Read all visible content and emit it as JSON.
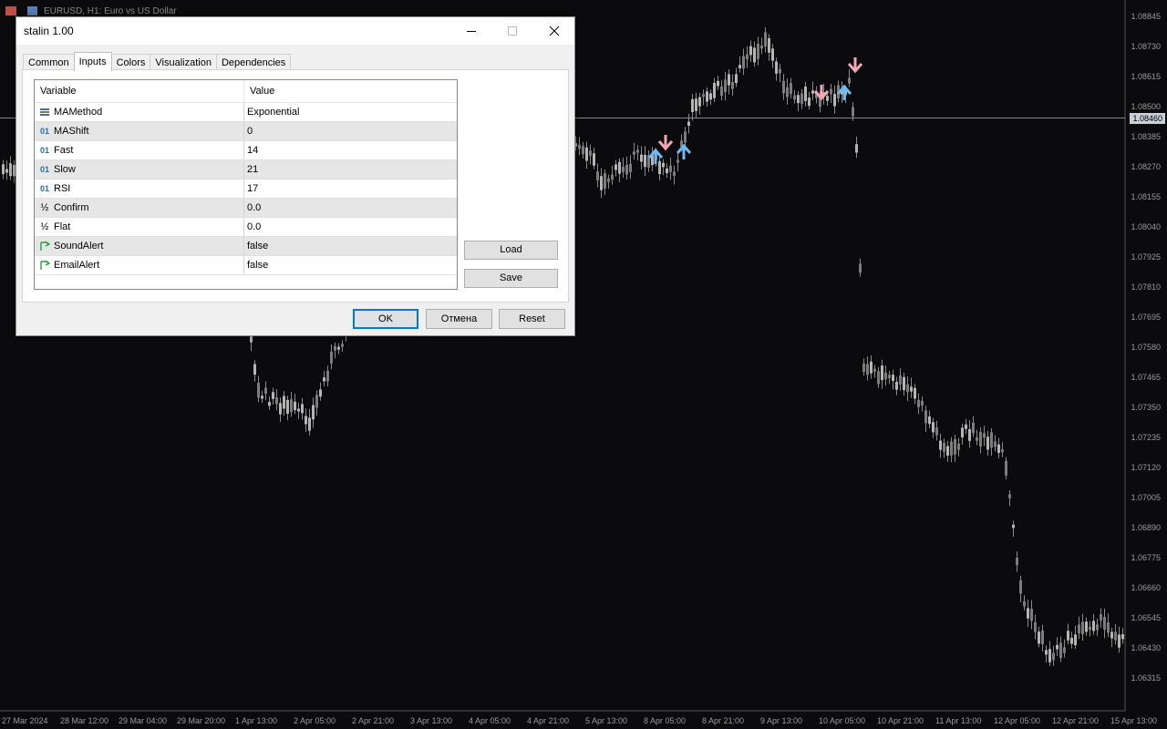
{
  "chart": {
    "title": "EURUSD, H1:  Euro vs US Dollar",
    "current_price": "1.08460",
    "price_labels": [
      "1.08845",
      "1.08730",
      "1.08615",
      "1.08500",
      "1.08385",
      "1.08270",
      "1.08155",
      "1.08040",
      "1.07925",
      "1.07810",
      "1.07695",
      "1.07580",
      "1.07465",
      "1.07350",
      "1.07235",
      "1.07120",
      "1.07005",
      "1.06890",
      "1.06775",
      "1.06660",
      "1.06545",
      "1.06430",
      "1.06315"
    ],
    "time_labels": [
      "27 Mar 2024",
      "28 Mar 12:00",
      "29 Mar 04:00",
      "29 Mar 20:00",
      "1 Apr 13:00",
      "2 Apr 05:00",
      "2 Apr 21:00",
      "3 Apr 13:00",
      "4 Apr 05:00",
      "4 Apr 21:00",
      "5 Apr 13:00",
      "8 Apr 05:00",
      "8 Apr 21:00",
      "9 Apr 13:00",
      "10 Apr 05:00",
      "10 Apr 21:00",
      "11 Apr 13:00",
      "12 Apr 05:00",
      "12 Apr 21:00",
      "15 Apr 13:00"
    ]
  },
  "dialog": {
    "title": "stalin 1.00",
    "tabs": [
      "Common",
      "Inputs",
      "Colors",
      "Visualization",
      "Dependencies"
    ],
    "active_tab": "Inputs",
    "columns": {
      "variable": "Variable",
      "value": "Value"
    },
    "params": [
      {
        "name": "MAMethod",
        "value": "Exponential",
        "icon": "enum-icon"
      },
      {
        "name": "MAShift",
        "value": "0",
        "icon": "int-icon"
      },
      {
        "name": "Fast",
        "value": "14",
        "icon": "int-icon"
      },
      {
        "name": "Slow",
        "value": "21",
        "icon": "int-icon"
      },
      {
        "name": "RSI",
        "value": "17",
        "icon": "int-icon"
      },
      {
        "name": "Confirm",
        "value": "0.0",
        "icon": "double-icon"
      },
      {
        "name": "Flat",
        "value": "0.0",
        "icon": "double-icon"
      },
      {
        "name": "SoundAlert",
        "value": "false",
        "icon": "bool-icon"
      },
      {
        "name": "EmailAlert",
        "value": "false",
        "icon": "bool-icon"
      }
    ],
    "icon_text": {
      "int": "01",
      "double": "½"
    },
    "buttons": {
      "load": "Load",
      "save": "Save",
      "ok": "OK",
      "cancel": "Отмена",
      "reset": "Reset"
    }
  }
}
